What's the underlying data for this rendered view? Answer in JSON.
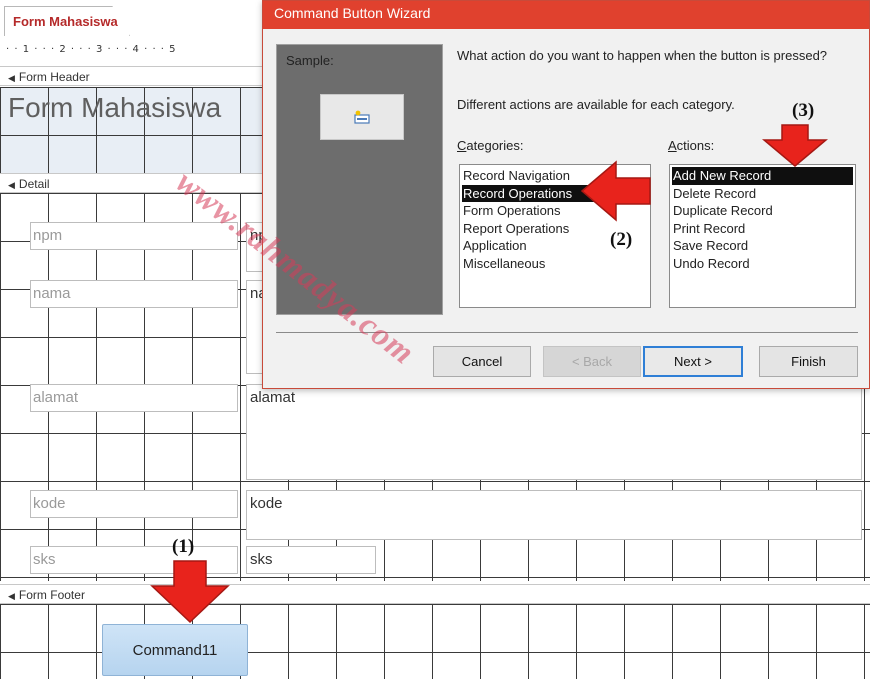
{
  "document_tab": {
    "label": "Form Mahasiswa"
  },
  "ruler": {
    "text": "· · 1 · · · 2 · · · 3 · · · 4 · · · 5"
  },
  "sections": {
    "form_header": "Form Header",
    "detail": "Detail",
    "form_footer": "Form Footer"
  },
  "header_title": "Form Mahasiswa",
  "fields": {
    "npm_label": "npm",
    "npm_value": "np",
    "nama_label": "nama",
    "nama_value": "na",
    "alamat_label": "alamat",
    "alamat_value": "alamat",
    "kode_label": "kode",
    "kode_value": "kode",
    "sks_label": "sks",
    "sks_value": "sks"
  },
  "command_button": {
    "label": "Command11"
  },
  "annotations": {
    "one": "(1)",
    "two": "(2)",
    "three": "(3)"
  },
  "wizard": {
    "title": "Command Button Wizard",
    "sample_label": "Sample:",
    "question": "What action do you want to happen when the button is pressed?",
    "subtext": "Different actions are available for each category.",
    "categories_label_prefix": "C",
    "categories_label_rest": "ategories:",
    "actions_label_prefix": "A",
    "actions_label_rest": "ctions:",
    "categories": [
      "Record Navigation",
      "Record Operations",
      "Form Operations",
      "Report Operations",
      "Application",
      "Miscellaneous"
    ],
    "actions": [
      "Add New Record",
      "Delete Record",
      "Duplicate Record",
      "Print Record",
      "Save Record",
      "Undo Record"
    ],
    "selected_category": "Record Operations",
    "selected_action": "Add New Record",
    "buttons": {
      "cancel": "Cancel",
      "back": "< Back",
      "next": "Next >",
      "finish": "Finish"
    }
  },
  "watermark": "www.rahmadya.com",
  "colors": {
    "title_bar": "#e0412e",
    "arrow_red": "#e8231c",
    "command_button": "#c5dcf2",
    "selection": "#0f0f0f"
  }
}
